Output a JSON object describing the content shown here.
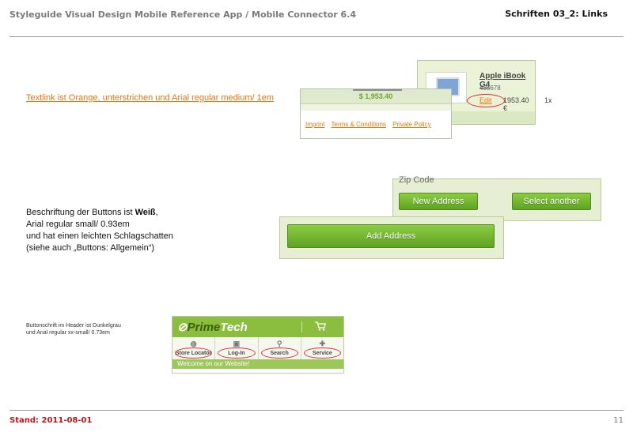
{
  "header": {
    "left_title": "Styleguide Visual Design Mobile Reference App / Mobile Connector 6.4",
    "right_title": "Schriften 03_2: Links"
  },
  "footer": {
    "stand": "Stand: 2011-08-01",
    "page_number": "11"
  },
  "section_links": {
    "description": "Textlink ist Orange, unterstrichen und Arial regular medium/ 1em",
    "product": {
      "title": "Apple iBook G4",
      "sku": "435678",
      "edit_label": "Edit",
      "price": "1953.40 €",
      "qty": "1x"
    },
    "footer_panel": {
      "total": "$ 1,953.40",
      "links": [
        "Imprint",
        "Terms & Conditions",
        "Private Policy"
      ]
    }
  },
  "section_buttons": {
    "description_line1_prefix": "Beschriftung der Buttons ist ",
    "description_line1_bold": "Weiß",
    "description_line1_suffix": ",",
    "description_line2": "Arial regular small/ 0.93em",
    "description_line3": "und hat einen leichten Schlagschatten",
    "description_line4": "(siehe auch „Buttons: Allgemein“)",
    "zip_label": "Zip Code",
    "new_address": "New Address",
    "select_another": "Select another",
    "add_address": "Add Address"
  },
  "section_header": {
    "description_line1": "Buttonschrift im Header ist Dunkelgrau",
    "description_line2": "und Arial regular xx-small/ 0.73em",
    "logo_part1": "Prime",
    "logo_part2": "Tech",
    "nav_buttons": [
      "Store Locator",
      "Log-In",
      "Search",
      "Service"
    ],
    "welcome": "Welcome on our Website!"
  },
  "colors": {
    "link_orange": "#e8740c",
    "brand_green": "#8bbd3f",
    "footer_red": "#c0141c"
  }
}
